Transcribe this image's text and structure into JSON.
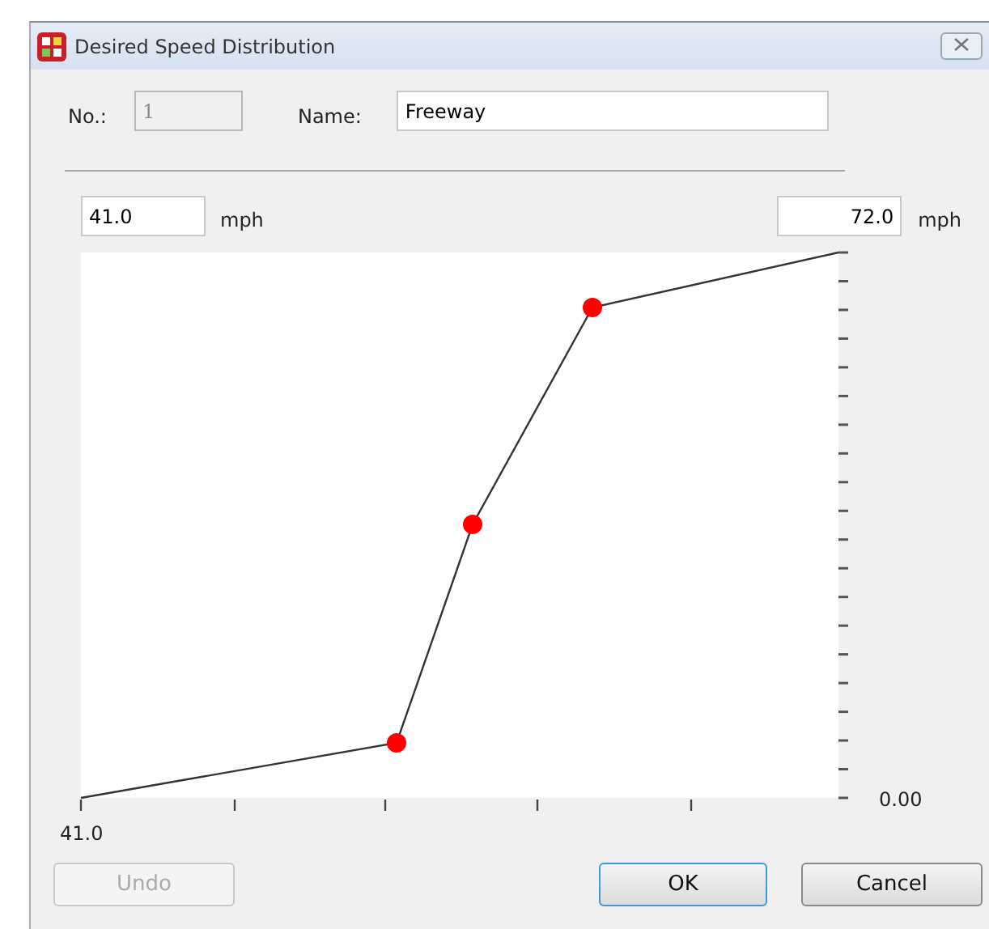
{
  "window": {
    "title": "Desired Speed Distribution"
  },
  "fields": {
    "number": {
      "label": "No.:",
      "value": "1",
      "disabled": true
    },
    "name": {
      "label": "Name:",
      "value": "Freeway"
    }
  },
  "range": {
    "min": {
      "value": "41.0",
      "unit": "mph"
    },
    "max": {
      "value": "72.0",
      "unit": "mph"
    }
  },
  "chart": {
    "x_axis_label": "41.0",
    "y_axis_label": "0.00"
  },
  "buttons": [
    {
      "label": "Undo",
      "disabled": true,
      "default": false
    },
    {
      "label": "OK",
      "disabled": false,
      "default": true
    },
    {
      "label": "Cancel",
      "disabled": false,
      "default": false
    }
  ]
}
